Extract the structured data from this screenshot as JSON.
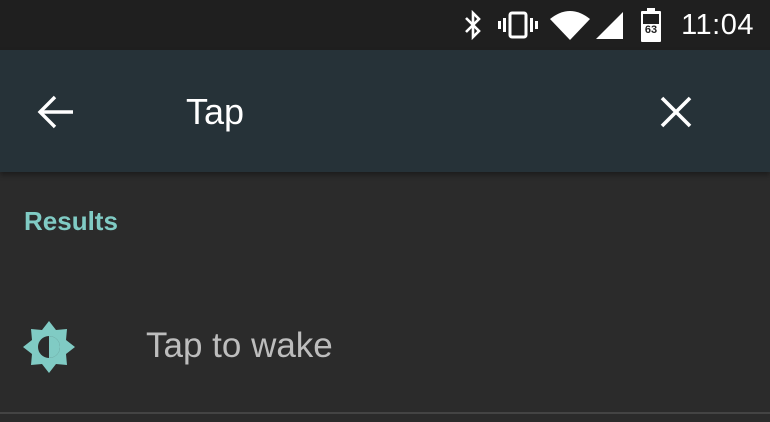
{
  "status_bar": {
    "time": "11:04",
    "battery_level": "63",
    "icons": [
      "bluetooth-icon",
      "vibrate-icon",
      "wifi-icon",
      "cell-signal-icon",
      "battery-icon"
    ]
  },
  "search": {
    "back_icon": "arrow-back-icon",
    "query": "Tap",
    "clear_icon": "close-icon"
  },
  "results": {
    "header": "Results",
    "items": [
      {
        "icon": "brightness-icon",
        "label": "Tap to wake"
      }
    ]
  },
  "colors": {
    "status_bar_bg": "#1f1f1f",
    "toolbar_bg": "#263238",
    "content_bg": "#2b2b2b",
    "accent": "#80cbc4",
    "primary_text": "#ffffff",
    "secondary_text": "#bdbdbd"
  }
}
